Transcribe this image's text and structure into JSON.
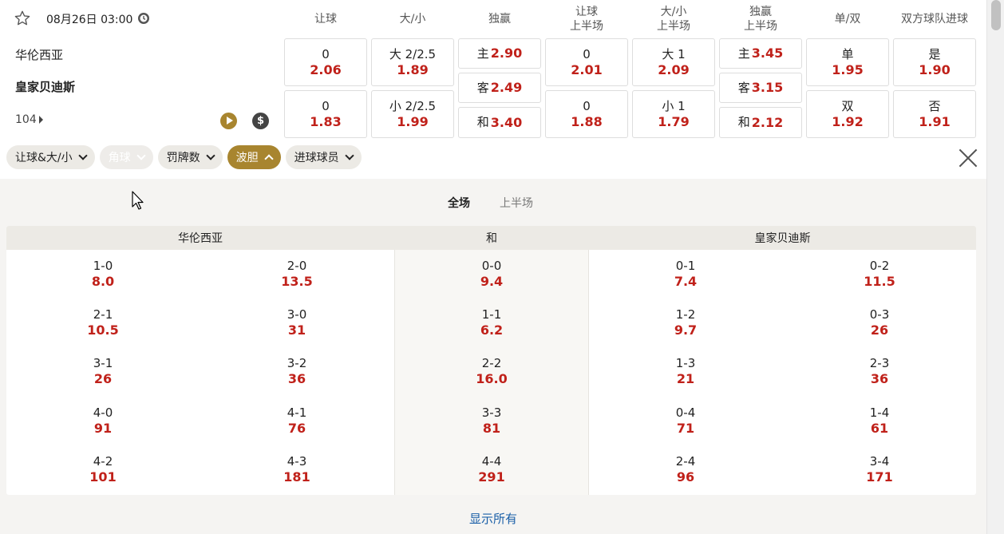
{
  "match": {
    "datetime": "08月26日 03:00",
    "home": "华伦西亚",
    "away": "皇家贝迪斯",
    "more_markets": "104"
  },
  "columns": [
    {
      "line1": "让球",
      "line2": ""
    },
    {
      "line1": "大/小",
      "line2": ""
    },
    {
      "line1": "独赢",
      "line2": ""
    },
    {
      "line1": "让球",
      "line2": "上半场"
    },
    {
      "line1": "大/小",
      "line2": "上半场"
    },
    {
      "line1": "独赢",
      "line2": "上半场"
    },
    {
      "line1": "单/双",
      "line2": ""
    },
    {
      "line1": "双方球队进球",
      "line2": ""
    }
  ],
  "odds": {
    "handicap": {
      "home_line": "0",
      "home_odd": "2.06",
      "away_line": "0",
      "away_odd": "1.83"
    },
    "total": {
      "over_line": "大 2/2.5",
      "over_odd": "1.89",
      "under_line": "小 2/2.5",
      "under_odd": "1.99"
    },
    "moneyline": {
      "home_label": "主",
      "home_odd": "2.90",
      "away_label": "客",
      "away_odd": "2.49",
      "draw_label": "和",
      "draw_odd": "3.40"
    },
    "handicap_1h": {
      "home_line": "0",
      "home_odd": "2.01",
      "away_line": "0",
      "away_odd": "1.88"
    },
    "total_1h": {
      "over_line": "大 1",
      "over_odd": "2.09",
      "under_line": "小 1",
      "under_odd": "1.79"
    },
    "moneyline_1h": {
      "home_label": "主",
      "home_odd": "3.45",
      "away_label": "客",
      "away_odd": "3.15",
      "draw_label": "和",
      "draw_odd": "2.12"
    },
    "odd_even": {
      "odd_label": "单",
      "odd_odd": "1.95",
      "even_label": "双",
      "even_odd": "1.92"
    },
    "btts": {
      "yes_label": "是",
      "yes_odd": "1.90",
      "no_label": "否",
      "no_odd": "1.91"
    }
  },
  "filters": [
    {
      "label": "让球&大/小",
      "state": "normal"
    },
    {
      "label": "角球",
      "state": "disabled"
    },
    {
      "label": "罚牌数",
      "state": "normal"
    },
    {
      "label": "波胆",
      "state": "active"
    },
    {
      "label": "进球球员",
      "state": "normal"
    }
  ],
  "correct_score": {
    "tabs": [
      "全场",
      "上半场"
    ],
    "active_tab": "全场",
    "headers": {
      "home": "华伦西亚",
      "draw": "和",
      "away": "皇家贝迪斯"
    },
    "home_left": [
      {
        "score": "1-0",
        "odd": "8.0"
      },
      {
        "score": "2-1",
        "odd": "10.5"
      },
      {
        "score": "3-1",
        "odd": "26"
      },
      {
        "score": "4-0",
        "odd": "91"
      },
      {
        "score": "4-2",
        "odd": "101"
      }
    ],
    "home_right": [
      {
        "score": "2-0",
        "odd": "13.5"
      },
      {
        "score": "3-0",
        "odd": "31"
      },
      {
        "score": "3-2",
        "odd": "36"
      },
      {
        "score": "4-1",
        "odd": "76"
      },
      {
        "score": "4-3",
        "odd": "181"
      }
    ],
    "draw": [
      {
        "score": "0-0",
        "odd": "9.4"
      },
      {
        "score": "1-1",
        "odd": "6.2"
      },
      {
        "score": "2-2",
        "odd": "16.0"
      },
      {
        "score": "3-3",
        "odd": "81"
      },
      {
        "score": "4-4",
        "odd": "291"
      }
    ],
    "away_left": [
      {
        "score": "0-1",
        "odd": "7.4"
      },
      {
        "score": "1-2",
        "odd": "9.7"
      },
      {
        "score": "1-3",
        "odd": "21"
      },
      {
        "score": "0-4",
        "odd": "71"
      },
      {
        "score": "2-4",
        "odd": "96"
      }
    ],
    "away_right": [
      {
        "score": "0-2",
        "odd": "11.5"
      },
      {
        "score": "0-3",
        "odd": "26"
      },
      {
        "score": "2-3",
        "odd": "36"
      },
      {
        "score": "1-4",
        "odd": "61"
      },
      {
        "score": "3-4",
        "odd": "171"
      }
    ],
    "show_all": "显示所有"
  },
  "colors": {
    "accent": "#a8852f",
    "odds": "#c0211a",
    "link": "#1a5fa8"
  }
}
